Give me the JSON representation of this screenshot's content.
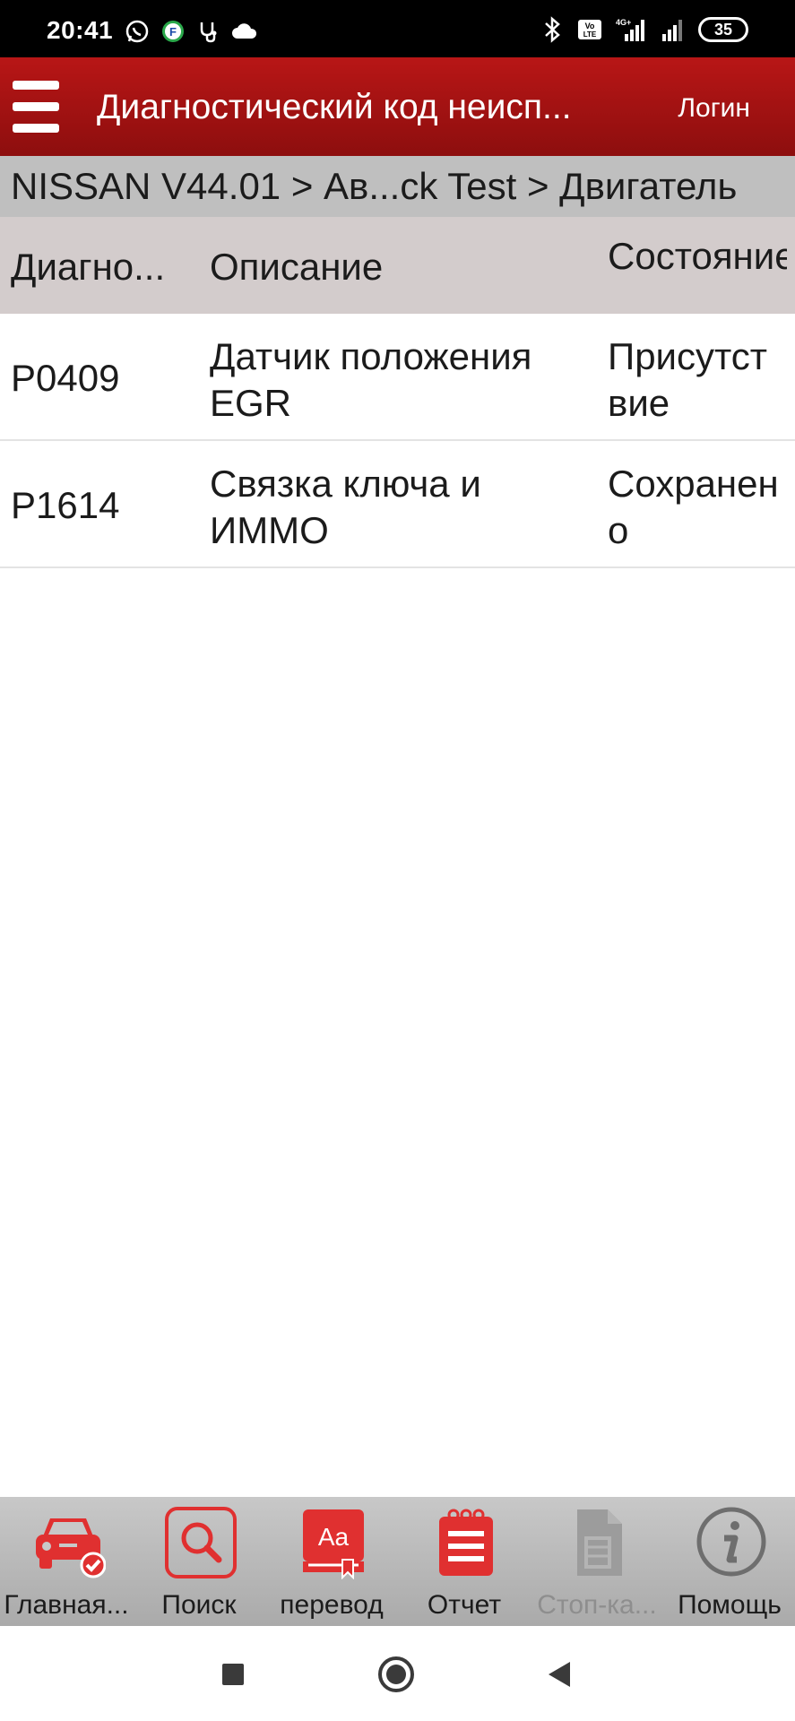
{
  "status_bar": {
    "time": "20:41",
    "battery": "35",
    "icons": [
      "whatsapp-icon",
      "f-app-icon",
      "stethoscope-icon",
      "cloud-icon",
      "bluetooth-icon",
      "volte-icon",
      "signal-4g-icon",
      "signal-icon",
      "battery-icon"
    ]
  },
  "app_bar": {
    "title": "Диагностический код неисп...",
    "login": "Логин"
  },
  "breadcrumb": "NISSAN V44.01 > Ав...ck Test > Двигатель",
  "table": {
    "headers": {
      "code": "Диагно...",
      "description": "Описание",
      "state": "Состояние"
    },
    "rows": [
      {
        "code": "P0409",
        "description": "Датчик положения EGR",
        "state": "Присутствие"
      },
      {
        "code": "P1614",
        "description": "Связка ключа и ИММО",
        "state": "Сохранено"
      }
    ]
  },
  "toolbar": {
    "items": [
      {
        "label": "Главная...",
        "icon": "car-check-icon"
      },
      {
        "label": "Поиск",
        "icon": "search-icon"
      },
      {
        "label": "перевод",
        "icon": "translate-icon"
      },
      {
        "label": "Отчет",
        "icon": "report-icon"
      },
      {
        "label": "Стоп-ка...",
        "icon": "freeze-frame-icon"
      },
      {
        "label": "Помощь",
        "icon": "help-icon"
      }
    ]
  },
  "colors": {
    "app_bar": "#a31212",
    "accent_red": "#e03030",
    "breadcrumb_bg": "#bfbfbf",
    "header_bg": "#d3cccc"
  }
}
